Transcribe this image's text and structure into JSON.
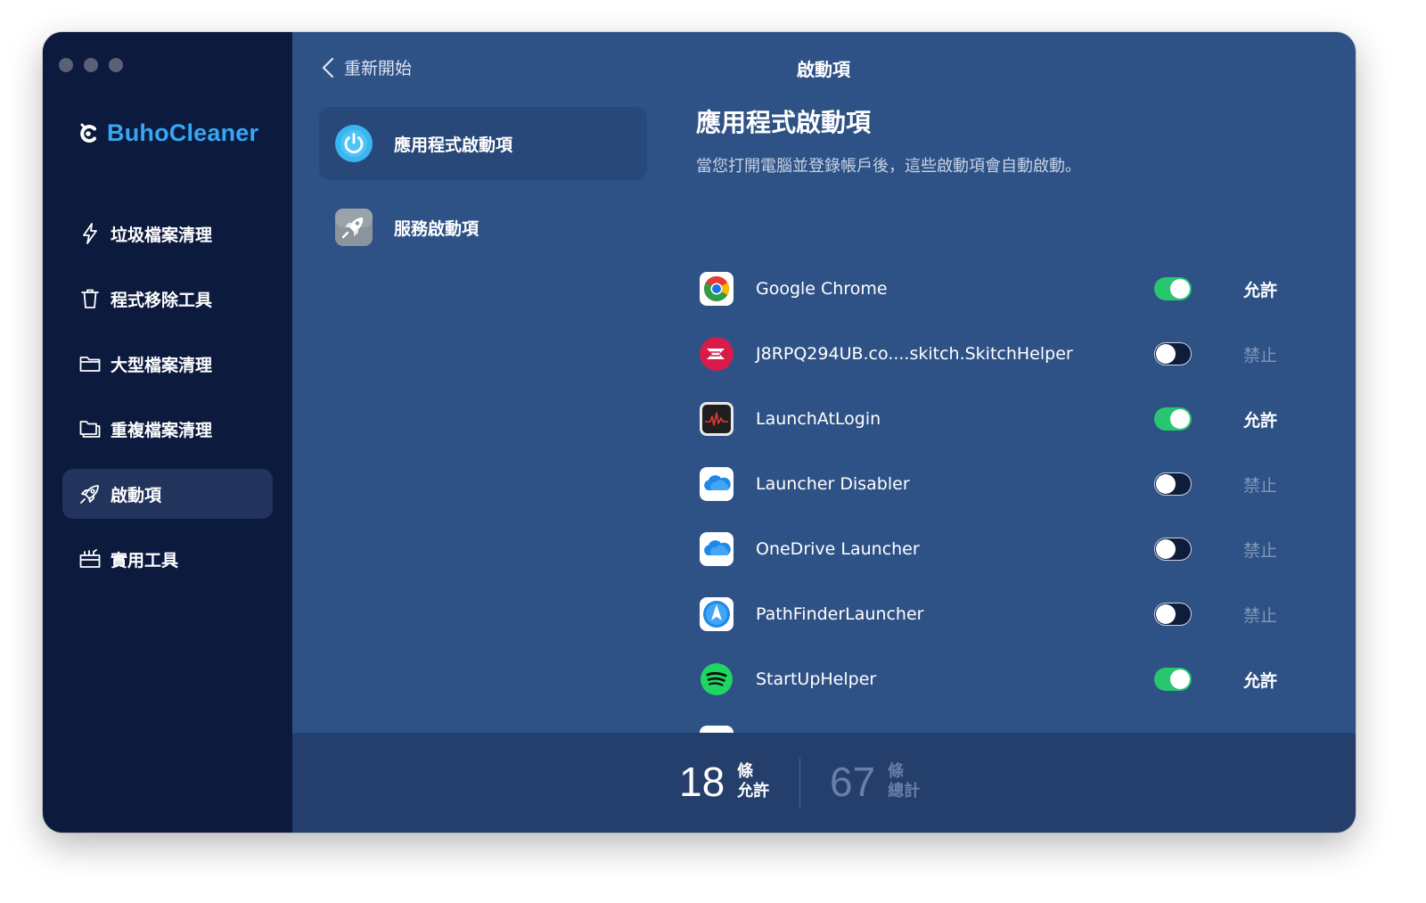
{
  "app": {
    "name": "BuhoCleaner"
  },
  "sidebar": {
    "items": [
      {
        "label": "垃圾檔案清理",
        "icon": "bolt-icon"
      },
      {
        "label": "程式移除工具",
        "icon": "trash-icon"
      },
      {
        "label": "大型檔案清理",
        "icon": "folder-icon"
      },
      {
        "label": "重複檔案清理",
        "icon": "duplicate-folder-icon"
      },
      {
        "label": "啟動項",
        "icon": "rocket-icon",
        "active": true
      },
      {
        "label": "實用工具",
        "icon": "toolbox-icon"
      }
    ]
  },
  "header": {
    "back_label": "重新開始",
    "title": "啟動項"
  },
  "categories": [
    {
      "label": "應用程式啟動項",
      "icon": "power-icon",
      "active": true
    },
    {
      "label": "服務啟動項",
      "icon": "rocket-app-icon",
      "active": false
    }
  ],
  "main": {
    "title": "應用程式啟動項",
    "subtitle": "當您打開電腦並登錄帳戶後，這些啟動項會自動啟動。"
  },
  "apps": [
    {
      "name": "Google Chrome",
      "enabled": true,
      "state_label": "允許",
      "icon": "chrome-icon"
    },
    {
      "name": "J8RPQ294UB.co....skitch.SkitchHelper",
      "enabled": false,
      "state_label": "禁止",
      "icon": "skitch-icon"
    },
    {
      "name": "LaunchAtLogin",
      "enabled": true,
      "state_label": "允許",
      "icon": "activity-monitor-icon"
    },
    {
      "name": "Launcher Disabler",
      "enabled": false,
      "state_label": "禁止",
      "icon": "onedrive-icon"
    },
    {
      "name": "OneDrive Launcher",
      "enabled": false,
      "state_label": "禁止",
      "icon": "onedrive-icon"
    },
    {
      "name": "PathFinderLauncher",
      "enabled": false,
      "state_label": "禁止",
      "icon": "pathfinder-icon"
    },
    {
      "name": "StartUpHelper",
      "enabled": true,
      "state_label": "允許",
      "icon": "spotify-icon"
    }
  ],
  "footer": {
    "allowed_count": "18",
    "allowed_unit": "條",
    "allowed_label": "允許",
    "total_count": "67",
    "total_unit": "條",
    "total_label": "總計"
  },
  "colors": {
    "sidebar_bg": "#0c1a3e",
    "main_bg": "#2f5286",
    "footer_bg": "#253f6c",
    "brand": "#37a6f3",
    "toggle_on": "#28c76f",
    "disabled_text": "#7f95b8"
  }
}
